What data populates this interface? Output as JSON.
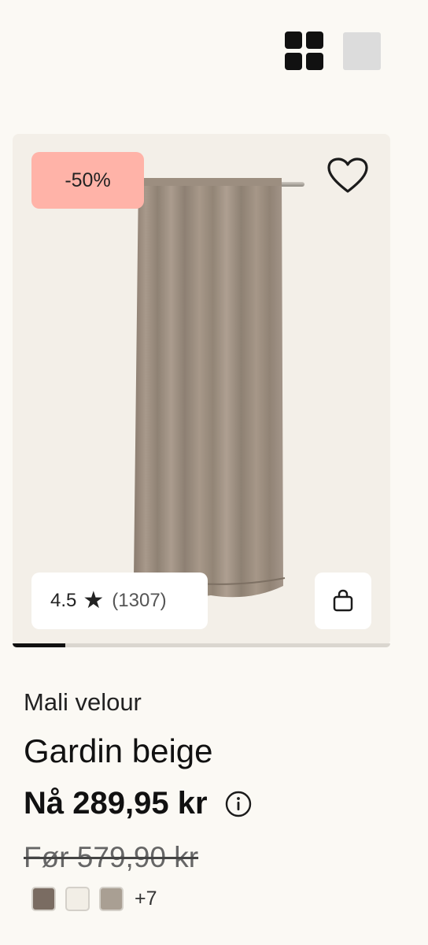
{
  "view_toggle": {
    "grid_icon": "grid-view-icon",
    "single_icon": "single-view-icon"
  },
  "product": {
    "discount_badge": "-50%",
    "rating": {
      "value": "4.5",
      "star": "★",
      "count": "(1307)"
    },
    "image_progress": 0.14,
    "brand": "Mali velour",
    "title": "Gardin beige",
    "price": "Nå 289,95 kr",
    "old_price": "Før 579,90 kr",
    "swatches": [
      {
        "color": "#7a6c62",
        "name": "brown"
      },
      {
        "color": "#f2eee6",
        "name": "off-white"
      },
      {
        "color": "#a99f93",
        "name": "taupe"
      }
    ],
    "more_colors": "+7"
  },
  "colors": {
    "background": "#fbf9f4",
    "card": "#f3efe8",
    "badge": "#ffb3a8",
    "curtain": "#9a8c7e"
  }
}
